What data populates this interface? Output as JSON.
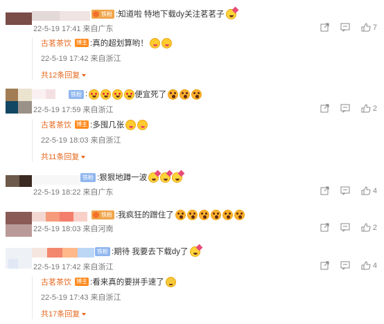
{
  "comments": [
    {
      "avatar_colors": [
        "#7a4d49",
        "#8b4c4a"
      ],
      "name_colors": [
        "#e3d9d6",
        "#d66e76"
      ],
      "fan_badge": "铁粉",
      "fan_badge_color": "#f0a54a",
      "text": ":知道啦 特地下载dy关注茗茗子",
      "emojis": [
        "party"
      ],
      "meta": "22-5-19 17:41 来自广东",
      "likes": "7",
      "replies": [
        {
          "name": "古茗茶饮",
          "badge": "博主",
          "text": ":真的超划算哟！",
          "emojis": [
            "tongue",
            "tongue"
          ],
          "meta": "22-5-19 17:42 来自浙江"
        }
      ],
      "more": "共12条回复"
    },
    {
      "avatar_colors": [
        "#a27c54",
        "#ece3cf",
        "#9a9189",
        "#114762",
        "#2a6a8a"
      ],
      "name_colors": [
        "#f4e0e3",
        "#f7e7e9"
      ],
      "fan_badge": "铁粉",
      "fan_badge_color": "#8fb6ef",
      "text": ":",
      "emojis": [
        "heart",
        "heart",
        "heart",
        "heart"
      ],
      "text2": "便宜死了",
      "emojis2": [
        "shock",
        "shock",
        "shock"
      ],
      "meta": "22-5-19 17:59 来自浙江",
      "likes": "2",
      "replies": [
        {
          "name": "古茗茶饮",
          "badge": "博主",
          "text": ":多囤几张",
          "emojis": [
            "tongue",
            "tongue"
          ],
          "meta": "22-5-19 18:03 来自浙江"
        }
      ],
      "more": "共11条回复"
    },
    {
      "avatar_colors": [
        "#6e5a4a",
        "#3a2a22"
      ],
      "name_colors": [
        "#eeeeee"
      ],
      "fan_badge": "铁粉",
      "fan_badge_color": "#8fb6ef",
      "text": ":狠狠地蹲一波",
      "emojis": [
        "party",
        "party",
        "party"
      ],
      "meta": "22-5-19 18:22 来自广东",
      "likes": "4",
      "replies": [],
      "more": ""
    },
    {
      "avatar_colors": [
        "#8a5a56",
        "#b99a98"
      ],
      "name_colors": [
        "#f2d8d1",
        "#f59a7b",
        "#f37e6b"
      ],
      "fan_badge": "铁粉",
      "fan_badge_color": "#f0a54a",
      "text": ":我疯狂的蹭住了",
      "emojis": [
        "shock",
        "shock",
        "shock",
        "shock",
        "shock",
        "shock"
      ],
      "meta": "22-5-19 18:03 来自河南",
      "likes": "2",
      "replies": [],
      "more": ""
    },
    {
      "avatar_colors": [
        "#dfe8f4",
        "#eef1f6"
      ],
      "name_colors": [
        "#f5e6e0",
        "#f2876e",
        "#ffb88a",
        "#bcd6f5"
      ],
      "fan_badge": "铁粉",
      "fan_badge_color": "#8fb6ef",
      "text": ":期待 我要去下载dy了",
      "emojis": [
        "party"
      ],
      "meta": "22-5-19 17:42 来自浙江",
      "likes": "4",
      "replies": [
        {
          "name": "古茗茶饮",
          "badge": "博主",
          "text": ":看来真的要拼手速了",
          "emojis": [
            "think"
          ],
          "meta": "22-5-19 17:43 来自浙江"
        }
      ],
      "more": "共17条回复"
    }
  ]
}
